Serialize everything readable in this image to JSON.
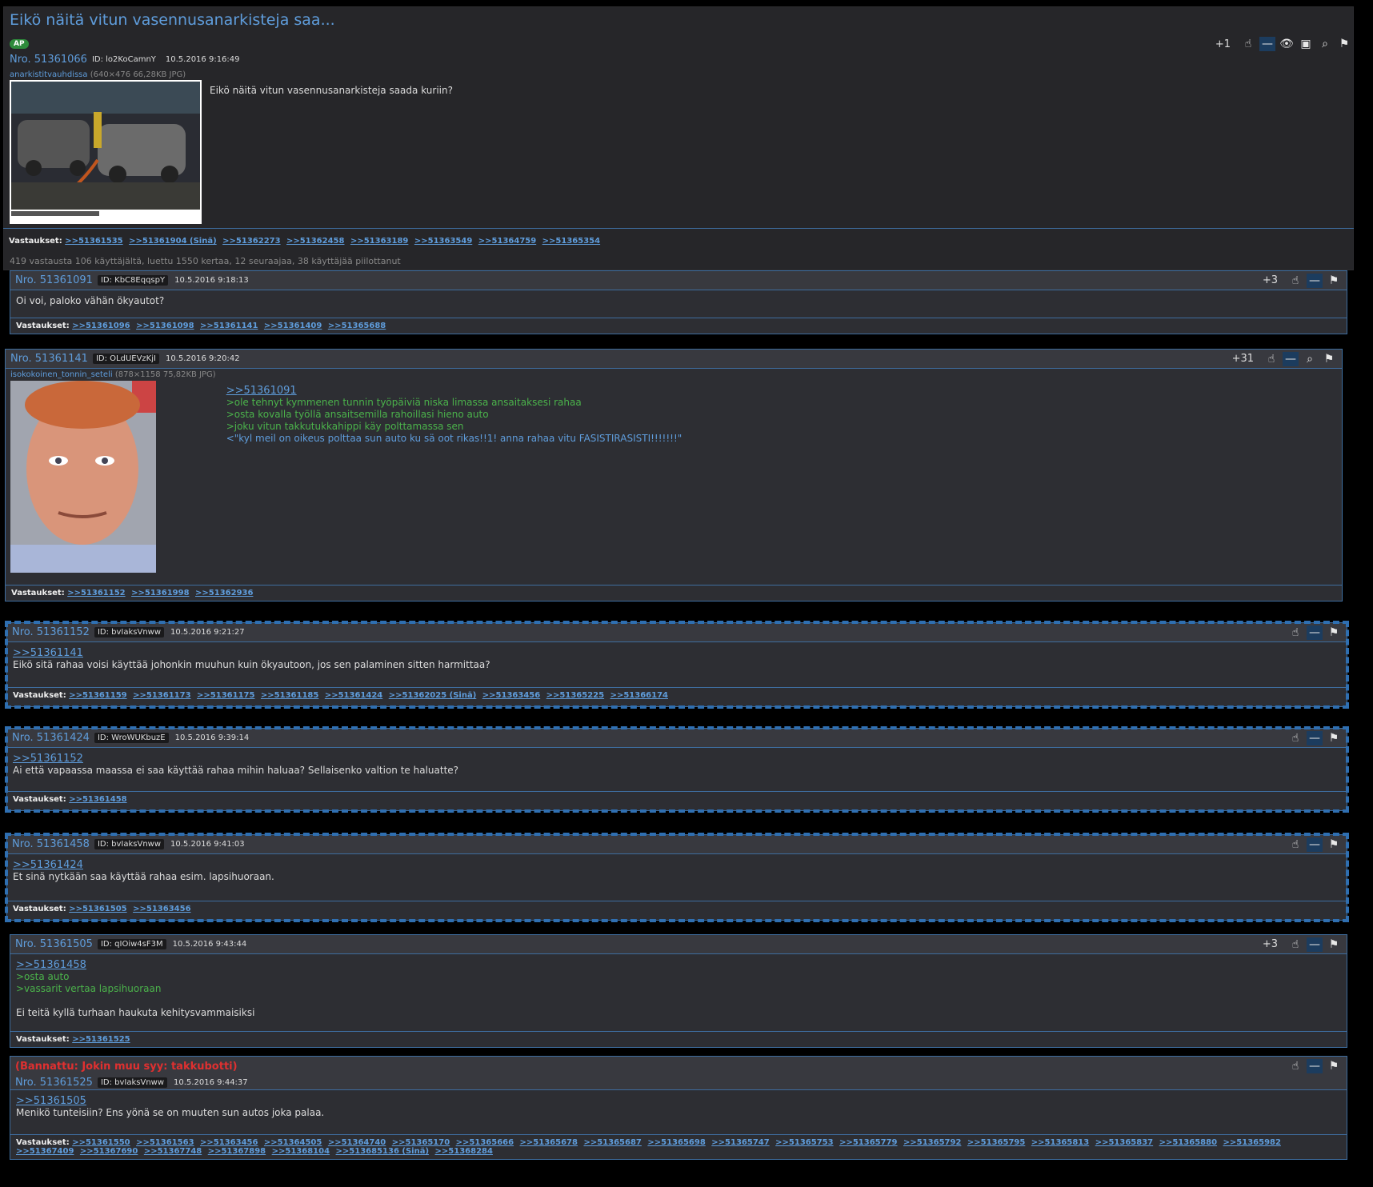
{
  "thread": {
    "title": "Eikö näitä vitun vasennusanarkisteja saa...",
    "ap_badge": "AP",
    "stats": "419 vastausta 106 käyttäjältä, luettu 1550 kertaa, 12 seuraajaa, 38 käyttäjää piilottanut"
  },
  "answers_label": "Vastaukset:",
  "icons": {
    "upvote": "hand-icon",
    "hide": "minus-icon",
    "follow": "eye-icon",
    "gallery": "image-icon",
    "search": "search-icon",
    "report": "flag-icon"
  },
  "colors": {
    "accent": "#5f9ddc",
    "greentext": "#4bb34b",
    "ban": "#e03030",
    "border": "#3e6d9f",
    "background": "#2d2e33"
  },
  "op": {
    "nro": "Nro. 51361066",
    "id": "ID: lo2KoCamnY",
    "date": "10.5.2016 9:16:49",
    "votes": "+1",
    "file_name": "anarkistitvauhdissa",
    "file_meta": "(640×476 66,28KB JPG)",
    "text": "Eikö näitä vitun vasennusanarkisteja saada kuriin?",
    "answers": [
      ">>51361535",
      ">>51361904 (Sinä)",
      ">>51362273",
      ">>51362458",
      ">>51363189",
      ">>51363549",
      ">>51364759",
      ">>51365354"
    ]
  },
  "posts": [
    {
      "nro": "Nro. 51361091",
      "id": "ID: KbC8EqqspY",
      "date": "10.5.2016 9:18:13",
      "votes": "+3",
      "lines": [
        "Oi voi, paloko vähän ökyautot?"
      ],
      "answers": [
        ">>51361096",
        ">>51361098",
        ">>51361141",
        ">>51361409",
        ">>51365688"
      ]
    },
    {
      "nro": "Nro. 51361141",
      "id": "ID: OLdUEVzKjI",
      "date": "10.5.2016 9:20:42",
      "votes": "+31",
      "file_name": "isokokoinen_tonnin_seteli",
      "file_meta": "(878×1158 75,82KB JPG)",
      "quote": ">>51361091",
      "green": [
        ">ole tehnyt kymmenen tunnin työpäiviä niska limassa ansaitaksesi rahaa",
        ">osta kovalla työllä ansaitsemilla rahoillasi hieno auto",
        ">joku vitun takkutukkahippi käy polttamassa sen"
      ],
      "blue": "<\"kyl meil on oikeus polttaa sun auto ku sä oot rikas!!1! anna rahaa vitu FASISTIRASISTI!!!!!!!\"",
      "answers": [
        ">>51361152",
        ">>51361998",
        ">>51362936"
      ]
    },
    {
      "nro": "Nro. 51361152",
      "id": "ID: bvIaksVnww",
      "date": "10.5.2016 9:21:27",
      "quote": ">>51361141",
      "lines": [
        "Eikö sitä rahaa voisi käyttää johonkin muuhun kuin ökyautoon, jos sen palaminen sitten harmittaa?"
      ],
      "answers": [
        ">>51361159",
        ">>51361173",
        ">>51361175",
        ">>51361185",
        ">>51361424",
        ">>51362025 (Sinä)",
        ">>51363456",
        ">>51365225",
        ">>51366174"
      ]
    },
    {
      "nro": "Nro. 51361424",
      "id": "ID: WroWUKbuzE",
      "date": "10.5.2016 9:39:14",
      "quote": ">>51361152",
      "lines": [
        "Ai että vapaassa maassa ei saa käyttää rahaa mihin haluaa? Sellaisenko valtion te haluatte?"
      ],
      "answers": [
        ">>51361458"
      ]
    },
    {
      "nro": "Nro. 51361458",
      "id": "ID: bvIaksVnww",
      "date": "10.5.2016 9:41:03",
      "quote": ">>51361424",
      "lines": [
        "Et sinä nytkään saa käyttää rahaa esim. lapsihuoraan."
      ],
      "answers": [
        ">>51361505",
        ">>51363456"
      ]
    },
    {
      "nro": "Nro. 51361505",
      "id": "ID: qIOiw4sF3M",
      "date": "10.5.2016 9:43:44",
      "votes": "+3",
      "quote": ">>51361458",
      "green": [
        ">osta auto",
        ">vassarit vertaa lapsihuoraan"
      ],
      "lines": [
        "Ei teitä kyllä turhaan haukuta kehitysvammaisiksi"
      ],
      "answers": [
        ">>51361525"
      ]
    },
    {
      "ban": "(Bannattu: Jokin muu syy: takkubotti)",
      "nro": "Nro. 51361525",
      "id": "ID: bvIaksVnww",
      "date": "10.5.2016 9:44:37",
      "quote": ">>51361505",
      "lines": [
        "Menikö tunteisiin? Ens yönä se on muuten sun autos joka palaa."
      ],
      "answers": [
        ">>51361550",
        ">>51361563",
        ">>51363456",
        ">>51364505",
        ">>51364740",
        ">>51365170",
        ">>51365666",
        ">>51365678",
        ">>51365687",
        ">>51365698",
        ">>51365747",
        ">>51365753",
        ">>51365779",
        ">>51365792",
        ">>51365795",
        ">>51365813",
        ">>51365837",
        ">>51365880",
        ">>51365982",
        ">>51367409",
        ">>51367690",
        ">>51367748",
        ">>51367898",
        ">>51368104",
        ">>513685136 (Sinä)",
        ">>51368284"
      ]
    }
  ]
}
